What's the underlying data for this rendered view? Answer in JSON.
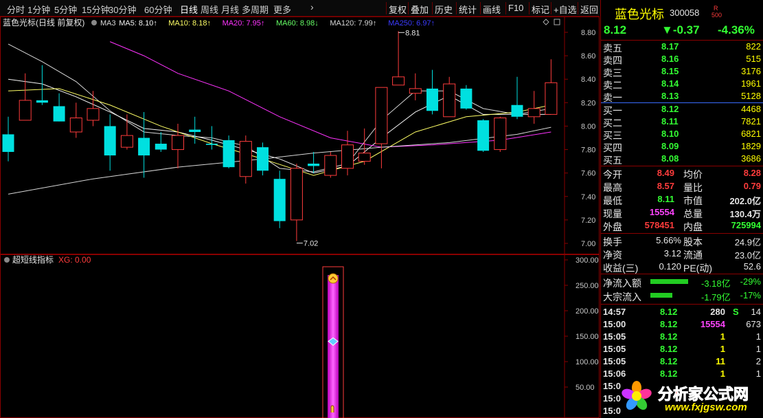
{
  "colors": {
    "up": "#ff3c3c",
    "down": "#00e0e0",
    "ma3": "#d8d8d8",
    "ma5": "#f5f5f5",
    "ma10": "#ffff66",
    "ma20": "#ff33ff",
    "ma60": "#66ff66",
    "ma120": "#d8d8d8",
    "ma250": "#3b3bff",
    "border": "#8a0000",
    "price": "#ff3c3c"
  },
  "topbar": {
    "tabs": [
      "分时",
      "1分钟",
      "5分钟",
      "15分钟",
      "30分钟",
      "60分钟",
      "日线",
      "周线",
      "月线",
      "多周期",
      "更多"
    ],
    "more_arrow": "›",
    "buttons": [
      "复权",
      "叠加",
      "历史",
      "统计",
      "画线",
      "F10",
      "标记",
      "+自选",
      "返回"
    ]
  },
  "main_chart": {
    "stock_name": "蓝色光标",
    "period": "(日线 前复权)",
    "ma_labels": [
      {
        "text": "MA3",
        "color": "#d8d8d8"
      },
      {
        "text": "MA5: 8.10↑",
        "color": "#f5f5f5"
      },
      {
        "text": "MA10: 8.18↑",
        "color": "#ffff66"
      },
      {
        "text": "MA20: 7.95↑",
        "color": "#ff33ff"
      },
      {
        "text": "MA60: 8.98↓",
        "color": "#66ff66"
      },
      {
        "text": "MA120: 7.99↑",
        "color": "#d8d8d8"
      },
      {
        "text": "MA250: 6.97↑",
        "color": "#3b3bff"
      }
    ],
    "high_label": "8.81",
    "low_label": "7.02",
    "y_ticks": [
      "8.80",
      "8.60",
      "8.40",
      "8.20",
      "8.00",
      "7.80",
      "7.60",
      "7.40",
      "7.20",
      "7.00"
    ],
    "y_range": [
      7.0,
      8.8
    ]
  },
  "chart_data": {
    "type": "candlestick",
    "candles": [
      {
        "o": 7.93,
        "c": 7.78,
        "h": 8.08,
        "l": 7.7
      },
      {
        "o": 8.05,
        "c": 8.22,
        "h": 8.45,
        "l": 8.05
      },
      {
        "o": 8.22,
        "c": 8.2,
        "h": 8.52,
        "l": 8.18
      },
      {
        "o": 8.17,
        "c": 8.04,
        "h": 8.28,
        "l": 8.04
      },
      {
        "o": 7.95,
        "c": 8.07,
        "h": 8.2,
        "l": 7.9
      },
      {
        "o": 8.05,
        "c": 8.15,
        "h": 8.3,
        "l": 8.0
      },
      {
        "o": 8.0,
        "c": 7.75,
        "h": 8.1,
        "l": 7.62
      },
      {
        "o": 7.82,
        "c": 7.92,
        "h": 8.1,
        "l": 7.8
      },
      {
        "o": 7.9,
        "c": 7.75,
        "h": 8.12,
        "l": 7.56
      },
      {
        "o": 7.85,
        "c": 7.8,
        "h": 7.95,
        "l": 7.78
      },
      {
        "o": 7.8,
        "c": 7.92,
        "h": 8.02,
        "l": 7.64
      },
      {
        "o": 7.97,
        "c": 7.95,
        "h": 8.08,
        "l": 7.85
      },
      {
        "o": 7.85,
        "c": 7.84,
        "h": 8.0,
        "l": 7.8
      },
      {
        "o": 7.88,
        "c": 7.65,
        "h": 7.92,
        "l": 7.64
      },
      {
        "o": 7.57,
        "c": 7.87,
        "h": 7.92,
        "l": 7.51
      },
      {
        "o": 7.82,
        "c": 7.62,
        "h": 7.86,
        "l": 7.58
      },
      {
        "o": 7.55,
        "c": 7.19,
        "h": 7.62,
        "l": 7.13
      },
      {
        "o": 7.2,
        "c": 7.64,
        "h": 7.68,
        "l": 7.02
      },
      {
        "o": 7.68,
        "c": 7.66,
        "h": 7.78,
        "l": 7.6
      },
      {
        "o": 7.58,
        "c": 7.75,
        "h": 7.78,
        "l": 7.56
      },
      {
        "o": 7.64,
        "c": 7.84,
        "h": 7.96,
        "l": 7.58
      },
      {
        "o": 7.7,
        "c": 7.77,
        "h": 7.98,
        "l": 7.67
      },
      {
        "o": 7.85,
        "c": 8.33,
        "h": 8.33,
        "l": 7.64
      },
      {
        "o": 8.35,
        "c": 8.42,
        "h": 8.81,
        "l": 8.35
      },
      {
        "o": 8.28,
        "c": 8.32,
        "h": 8.45,
        "l": 8.22
      },
      {
        "o": 8.32,
        "c": 8.13,
        "h": 8.48,
        "l": 8.1
      },
      {
        "o": 8.08,
        "c": 8.36,
        "h": 8.42,
        "l": 8.08
      },
      {
        "o": 8.32,
        "c": 8.15,
        "h": 8.35,
        "l": 8.14
      },
      {
        "o": 8.05,
        "c": 7.79,
        "h": 8.06,
        "l": 7.78
      },
      {
        "o": 7.8,
        "c": 8.07,
        "h": 8.08,
        "l": 7.78
      },
      {
        "o": 8.18,
        "c": 8.08,
        "h": 8.42,
        "l": 8.06
      },
      {
        "o": 8.08,
        "c": 8.15,
        "h": 8.3,
        "l": 8.02
      },
      {
        "o": 8.1,
        "c": 8.37,
        "h": 8.57,
        "l": 8.1
      }
    ],
    "ma_lines": [
      {
        "name": "MA3",
        "color": "#d8d8d8",
        "values": [
          [
            0,
            8.7
          ],
          [
            2,
            8.55
          ],
          [
            4,
            8.38
          ],
          [
            6,
            8.13
          ],
          [
            8,
            7.95
          ],
          [
            10,
            7.92
          ],
          [
            12,
            7.9
          ],
          [
            14,
            7.83
          ],
          [
            16,
            7.64
          ],
          [
            18,
            7.61
          ],
          [
            20,
            7.68
          ],
          [
            22,
            8.05
          ],
          [
            24,
            8.3
          ],
          [
            26,
            8.3
          ],
          [
            28,
            8.15
          ],
          [
            30,
            8.1
          ],
          [
            32,
            8.15
          ]
        ]
      },
      {
        "name": "MA5",
        "color": "#f5f5f5",
        "values": [
          [
            0,
            8.4
          ],
          [
            2,
            8.36
          ],
          [
            4,
            8.25
          ],
          [
            6,
            8.12
          ],
          [
            8,
            7.98
          ],
          [
            10,
            7.95
          ],
          [
            12,
            7.88
          ],
          [
            14,
            7.8
          ],
          [
            16,
            7.72
          ],
          [
            18,
            7.6
          ],
          [
            20,
            7.66
          ],
          [
            22,
            7.9
          ],
          [
            24,
            8.12
          ],
          [
            26,
            8.26
          ],
          [
            28,
            8.1
          ],
          [
            30,
            8.1
          ],
          [
            32,
            8.1
          ]
        ]
      },
      {
        "name": "MA10",
        "color": "#ffff66",
        "values": [
          [
            0,
            8.3
          ],
          [
            3,
            8.32
          ],
          [
            6,
            8.18
          ],
          [
            9,
            8.0
          ],
          [
            12,
            7.85
          ],
          [
            15,
            7.72
          ],
          [
            18,
            7.58
          ],
          [
            21,
            7.7
          ],
          [
            24,
            7.95
          ],
          [
            27,
            8.08
          ],
          [
            30,
            8.12
          ],
          [
            32,
            8.18
          ]
        ]
      },
      {
        "name": "MA20",
        "color": "#ff33ff",
        "values": [
          [
            6,
            8.72
          ],
          [
            8,
            8.6
          ],
          [
            10,
            8.45
          ],
          [
            13,
            8.3
          ],
          [
            16,
            8.08
          ],
          [
            19,
            7.9
          ],
          [
            22,
            7.82
          ],
          [
            25,
            7.84
          ],
          [
            29,
            7.88
          ],
          [
            32,
            7.95
          ]
        ]
      },
      {
        "name": "MA120",
        "color": "#d8d8d8",
        "values": [
          [
            0,
            7.42
          ],
          [
            5,
            7.55
          ],
          [
            10,
            7.65
          ],
          [
            15,
            7.72
          ],
          [
            18,
            7.77
          ],
          [
            22,
            7.82
          ],
          [
            26,
            7.86
          ],
          [
            30,
            7.93
          ],
          [
            32,
            7.99
          ]
        ]
      }
    ]
  },
  "sub_chart": {
    "title": "超短线指标",
    "xg_label": "XG: 0.00",
    "y_ticks": [
      "300.00",
      "250.00",
      "200.00",
      "150.00",
      "100.00",
      "50.00"
    ],
    "y_range": [
      0,
      300
    ]
  },
  "quote": {
    "name": "蓝色光标",
    "code": "300058",
    "badge_r": "R",
    "badge_num": "500",
    "price": "8.12",
    "change": "▼-0.37",
    "change_pct": "-4.36%",
    "asks": [
      {
        "label": "卖五",
        "price": "8.17",
        "vol": "822"
      },
      {
        "label": "卖四",
        "price": "8.16",
        "vol": "515"
      },
      {
        "label": "卖三",
        "price": "8.15",
        "vol": "3176"
      },
      {
        "label": "卖二",
        "price": "8.14",
        "vol": "1961"
      },
      {
        "label": "卖一",
        "price": "8.13",
        "vol": "5128"
      }
    ],
    "bids": [
      {
        "label": "买一",
        "price": "8.12",
        "vol": "4468"
      },
      {
        "label": "买二",
        "price": "8.11",
        "vol": "7821"
      },
      {
        "label": "买三",
        "price": "8.10",
        "vol": "6821"
      },
      {
        "label": "买四",
        "price": "8.09",
        "vol": "1829"
      },
      {
        "label": "买五",
        "price": "8.08",
        "vol": "3686"
      }
    ],
    "stats": [
      {
        "l1": "今开",
        "v1": "8.49",
        "c1": "#ff3c3c",
        "l2": "均价",
        "v2": "8.28",
        "c2": "#ff3c3c"
      },
      {
        "l1": "最高",
        "v1": "8.57",
        "c1": "#ff3c3c",
        "l2": "量比",
        "v2": "0.79",
        "c2": "#ff3c3c"
      },
      {
        "l1": "最低",
        "v1": "8.11",
        "c1": "#33ff33",
        "l2": "市值",
        "v2": "202.0亿",
        "c2": "#e6e6e6"
      },
      {
        "l1": "现量",
        "v1": "15554",
        "c1": "#ff44ff",
        "l2": "总量",
        "v2": "130.4万",
        "c2": "#e6e6e6"
      },
      {
        "l1": "外盘",
        "v1": "578451",
        "c1": "#ff3c3c",
        "l2": "内盘",
        "v2": "725994",
        "c2": "#33ff33"
      }
    ],
    "stats2": [
      {
        "l1": "换手",
        "v1": "5.66%",
        "l2": "股本",
        "v2": "24.9亿"
      },
      {
        "l1": "净资",
        "v1": "3.12",
        "l2": "流通",
        "v2": "23.0亿"
      },
      {
        "l1": "收益(三)",
        "v1": "0.120",
        "l2": "PE(动)",
        "v2": "52.6"
      }
    ],
    "flows": [
      {
        "label": "净流入额",
        "value": "-3.18亿",
        "pct": "-29%",
        "bar": 0.29
      },
      {
        "label": "大宗流入",
        "value": "-1.79亿",
        "pct": "-17%",
        "bar": 0.17
      }
    ],
    "ticks": [
      {
        "time": "14:57",
        "price": "8.12",
        "vol": "280",
        "flag": "S",
        "num": "14",
        "vc": "#e6e6e6"
      },
      {
        "time": "15:00",
        "price": "8.12",
        "vol": "15554",
        "flag": "",
        "num": "673",
        "vc": "#ff44ff"
      },
      {
        "time": "15:05",
        "price": "8.12",
        "vol": "1",
        "flag": "",
        "num": "1",
        "vc": "#ffff00"
      },
      {
        "time": "15:05",
        "price": "8.12",
        "vol": "1",
        "flag": "",
        "num": "1",
        "vc": "#ffff00"
      },
      {
        "time": "15:05",
        "price": "8.12",
        "vol": "11",
        "flag": "",
        "num": "2",
        "vc": "#ffff00"
      },
      {
        "time": "15:06",
        "price": "8.12",
        "vol": "1",
        "flag": "",
        "num": "1",
        "vc": "#ffff00"
      },
      {
        "time": "15:0",
        "price": "",
        "vol": "",
        "flag": "",
        "num": "",
        "vc": "#ffff00"
      },
      {
        "time": "15:0",
        "price": "",
        "vol": "",
        "flag": "",
        "num": "",
        "vc": "#ffff00"
      },
      {
        "time": "15:0",
        "price": "",
        "vol": "",
        "flag": "",
        "num": "",
        "vc": "#ffff00"
      }
    ]
  },
  "watermark": {
    "brand": "分析家公式网",
    "url": "www.fxjgsw.com"
  }
}
